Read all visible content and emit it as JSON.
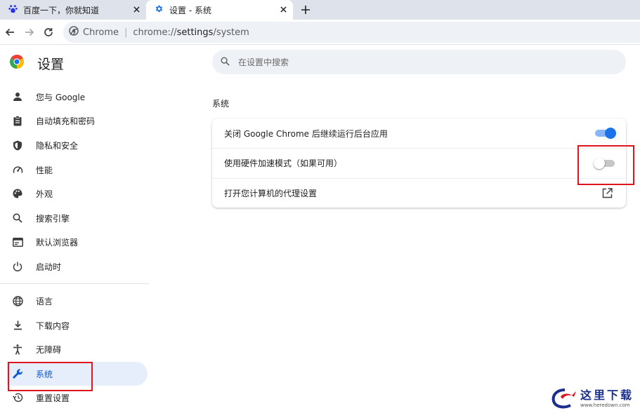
{
  "tabs": [
    {
      "title": "百度一下，你就知道",
      "icon": "baidu-paw-icon",
      "active": false
    },
    {
      "title": "设置 - 系统",
      "icon": "settings-gear-icon",
      "active": true
    }
  ],
  "toolbar": {
    "omnibox_label": "Chrome",
    "url_scheme_host": "chrome://",
    "url_path": "settings",
    "url_path_rest": "/system"
  },
  "sidebar": {
    "title": "设置",
    "items": [
      {
        "label": "您与 Google",
        "icon": "person-icon"
      },
      {
        "label": "自动填充和密码",
        "icon": "clipboard-icon"
      },
      {
        "label": "隐私和安全",
        "icon": "shield-icon"
      },
      {
        "label": "性能",
        "icon": "gauge-icon"
      },
      {
        "label": "外观",
        "icon": "palette-icon"
      },
      {
        "label": "搜索引擎",
        "icon": "search-icon"
      },
      {
        "label": "默认浏览器",
        "icon": "browser-window-icon"
      },
      {
        "label": "启动时",
        "icon": "power-icon"
      },
      {
        "label": "语言",
        "icon": "globe-icon"
      },
      {
        "label": "下载内容",
        "icon": "download-icon"
      },
      {
        "label": "无障碍",
        "icon": "accessibility-icon"
      },
      {
        "label": "系统",
        "icon": "wrench-icon",
        "active": true
      },
      {
        "label": "重置设置",
        "icon": "history-reset-icon"
      }
    ]
  },
  "search": {
    "placeholder": "在设置中搜索"
  },
  "section": {
    "title": "系统",
    "rows": [
      {
        "label": "关闭 Google Chrome 后继续运行后台应用",
        "control": "toggle",
        "checked": true
      },
      {
        "label": "使用硬件加速模式（如果可用）",
        "control": "toggle",
        "checked": false
      },
      {
        "label": "打开您计算机的代理设置",
        "control": "external-link"
      }
    ]
  },
  "colors": {
    "accent": "#1a73e8",
    "active_nav_bg": "#e6eefc",
    "annotation": "#e0141e"
  },
  "watermark": {
    "text": "这里下载",
    "url": "www.heredown.com"
  }
}
